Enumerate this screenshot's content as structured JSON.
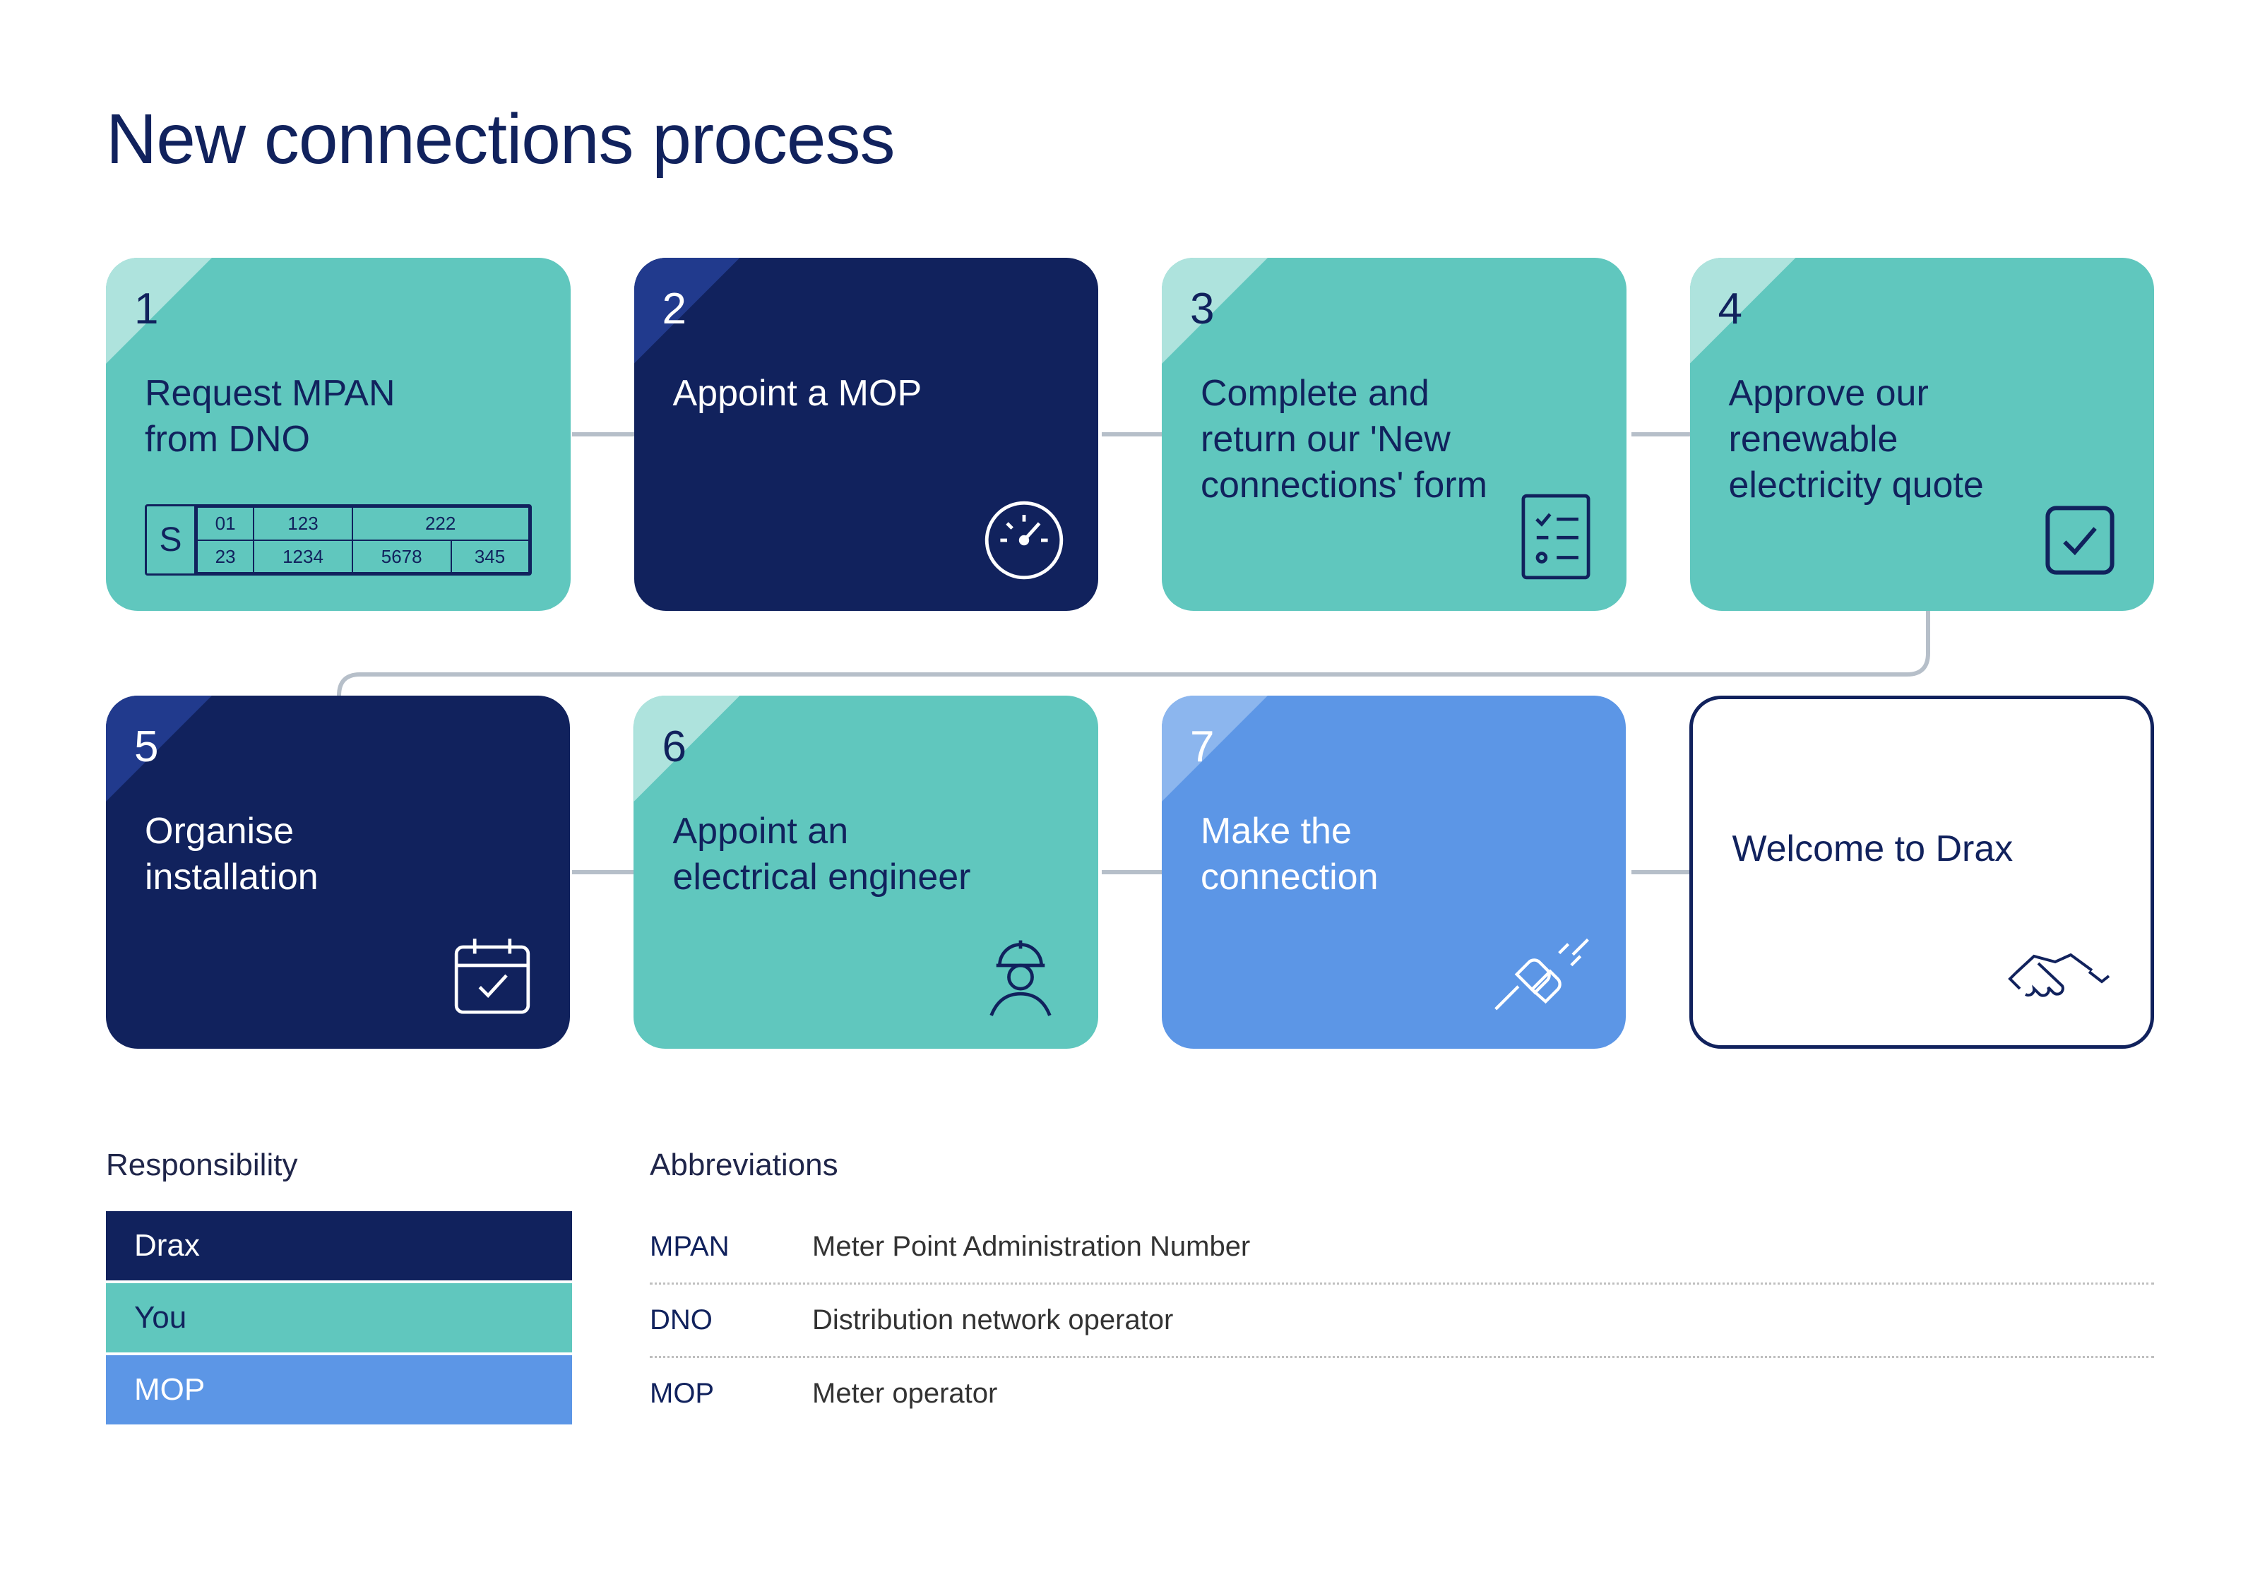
{
  "title": "New connections process",
  "steps": [
    {
      "num": "1",
      "title": "Request MPAN from DNO",
      "party": "you"
    },
    {
      "num": "2",
      "title": "Appoint a MOP",
      "party": "drax"
    },
    {
      "num": "3",
      "title": "Complete and return our 'New connections' form",
      "party": "you"
    },
    {
      "num": "4",
      "title": "Approve our renewable electricity quote",
      "party": "you"
    },
    {
      "num": "5",
      "title": "Organise installation",
      "party": "drax"
    },
    {
      "num": "6",
      "title": "Appoint an electrical engineer",
      "party": "you"
    },
    {
      "num": "7",
      "title": "Make the connection",
      "party": "mop"
    }
  ],
  "final": {
    "title": "Welcome to Drax"
  },
  "mpan": {
    "s": "S",
    "top": [
      "01",
      "123",
      "222"
    ],
    "bottom": [
      "23",
      "1234",
      "5678",
      "345"
    ]
  },
  "legend": {
    "responsibility": {
      "heading": "Responsibility",
      "items": [
        {
          "label": "Drax",
          "party": "drax"
        },
        {
          "label": "You",
          "party": "you"
        },
        {
          "label": "MOP",
          "party": "mop"
        }
      ]
    },
    "abbreviations": {
      "heading": "Abbreviations",
      "items": [
        {
          "k": "MPAN",
          "v": "Meter Point Administration Number"
        },
        {
          "k": "DNO",
          "v": "Distribution network operator"
        },
        {
          "k": "MOP",
          "v": "Meter operator"
        }
      ]
    }
  }
}
